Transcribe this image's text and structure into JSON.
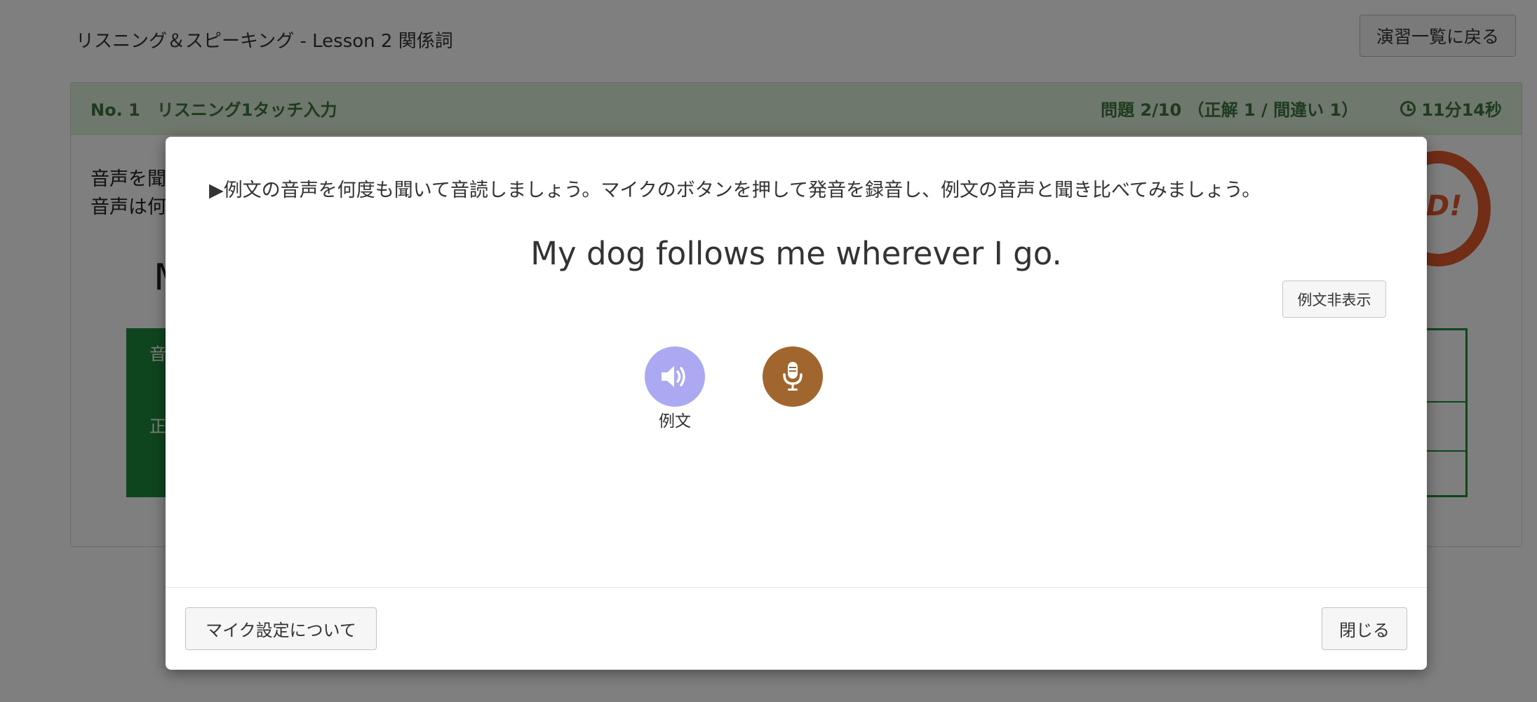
{
  "page": {
    "title": "リスニング＆スピーキング - Lesson 2 関係詞",
    "back_button": "演習一覧に戻る"
  },
  "panel": {
    "heading": "No. 1　リスニング1タッチ入力",
    "progress": "問題 2/10 （正解 1 / 間違い 1）",
    "timer": "11分14秒",
    "timer_icon": "clock-icon",
    "instruction_line1": "音声を聞",
    "instruction_line2": "音声は何",
    "sentence_partial": "M",
    "table_cells": [
      "音",
      "正",
      ""
    ],
    "stamp_text": "D!"
  },
  "modal": {
    "instruction": "▶例文の音声を何度も聞いて音読しましょう。マイクのボタンを押して発音を録音し、例文の音声と聞き比べてみましょう。",
    "sentence": "My dog follows me wherever I go.",
    "hide_sentence_button": "例文非表示",
    "audio_button_icon": "speaker-icon",
    "audio_button_label": "例文",
    "mic_button_icon": "microphone-icon",
    "mic_settings_button": "マイク設定について",
    "close_button": "閉じる"
  },
  "colors": {
    "panel_header_bg": "#dff0d8",
    "panel_header_text": "#3c763d",
    "table_green": "#1e8a3c",
    "audio_button": "#aba9f1",
    "mic_button": "#a1652e",
    "stamp": "#e25b2b"
  }
}
